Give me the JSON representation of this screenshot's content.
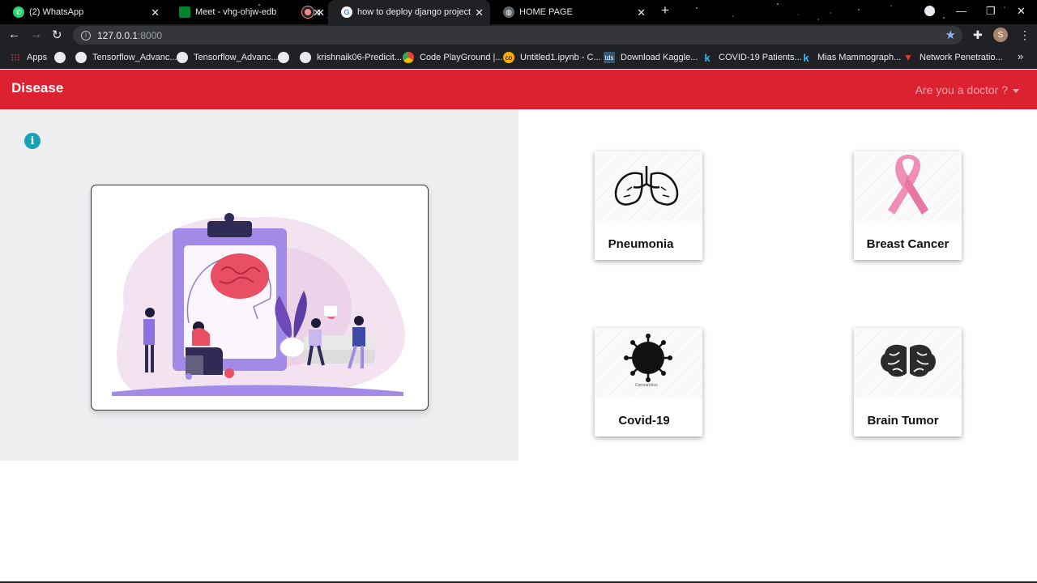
{
  "browser": {
    "tabs": [
      {
        "title": "(2) WhatsApp",
        "favicon": "whatsapp-icon"
      },
      {
        "title": "Meet - vhg-ohjw-edb",
        "favicon": "meet-icon"
      },
      {
        "title": "",
        "favicon": "recording-icon"
      },
      {
        "title": "how to deploy django project on",
        "favicon": "google-icon"
      },
      {
        "title": "HOME PAGE",
        "favicon": "globe-icon"
      }
    ],
    "url_host": "127.0.0.1",
    "url_port": ":8000",
    "avatar_letter": "S",
    "bookmarks": [
      {
        "label": "Apps",
        "icon": "apps-grid-icon"
      },
      {
        "label": "",
        "icon": "globe-icon"
      },
      {
        "label": "Tensorflow_Advanc...",
        "icon": "github-icon"
      },
      {
        "label": "Tensorflow_Advanc...",
        "icon": "github-icon"
      },
      {
        "label": "",
        "icon": "globe-icon"
      },
      {
        "label": "krishnaik06-Predicit...",
        "icon": "github-icon"
      },
      {
        "label": "Code PlayGround |...",
        "icon": "chrome-icon"
      },
      {
        "label": "Untitled1.ipynb - C...",
        "icon": "colab-icon"
      },
      {
        "label": "Download Kaggle...",
        "icon": "tds-icon"
      },
      {
        "label": "COVID-19 Patients...",
        "icon": "kaggle-icon"
      },
      {
        "label": "Mias Mammograph...",
        "icon": "kaggle-icon"
      },
      {
        "label": "Network Penetratio...",
        "icon": "network-icon"
      }
    ],
    "more_bookmarks": "»"
  },
  "navbar": {
    "brand": "Disease",
    "doctor_menu": "Are you a doctor ?"
  },
  "cards": [
    {
      "label": "Pneumonia",
      "icon": "lungs-icon"
    },
    {
      "label": "Breast Cancer",
      "icon": "pink-ribbon-icon"
    },
    {
      "label": "Covid-19",
      "icon": "coronavirus-icon",
      "caption": "CoronaVirus"
    },
    {
      "label": "Brain Tumor",
      "icon": "brain-icon"
    }
  ],
  "colors": {
    "navbar": "#dc2130",
    "info": "#17a2b8",
    "left_panel": "#efeff2"
  }
}
